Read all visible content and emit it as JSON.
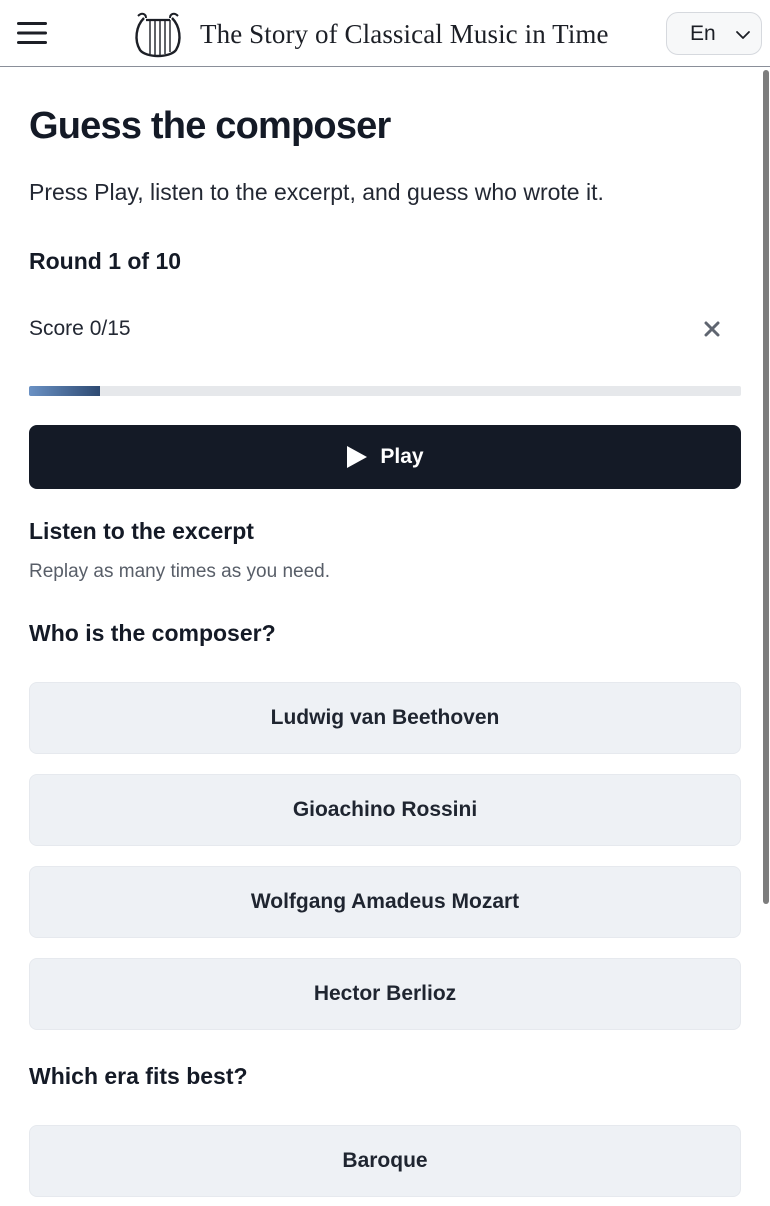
{
  "header": {
    "site_title": "The Story of Classical Music in Time",
    "language": "En",
    "icons": {
      "menu": "hamburger-menu-icon",
      "logo": "lyre-logo-icon",
      "language_dropdown": "chevron-down-icon"
    }
  },
  "main": {
    "title": "Guess the composer",
    "intro": "Press Play, listen to the excerpt, and guess who wrote it.",
    "round_label": "Round 1 of 10",
    "score_label": "Score 0/15",
    "progress_fraction": 0.1,
    "close_icon": "close-icon",
    "play_button_label": "Play",
    "play_icon": "play-triangle-icon",
    "listen_heading": "Listen to the excerpt",
    "listen_hint": "Replay as many times as you need.",
    "composer_question": "Who is the composer?",
    "composer_options": [
      "Ludwig van Beethoven",
      "Gioachino Rossini",
      "Wolfgang Amadeus Mozart",
      "Hector Berlioz"
    ],
    "era_question": "Which era fits best?",
    "era_options": [
      "Baroque"
    ]
  },
  "colors": {
    "primary_dark": "#141a26",
    "option_background": "#eef1f5",
    "progress_track": "#e6e8eb",
    "progress_fill_start": "#6a91c4",
    "progress_fill_end": "#2e4a72"
  }
}
